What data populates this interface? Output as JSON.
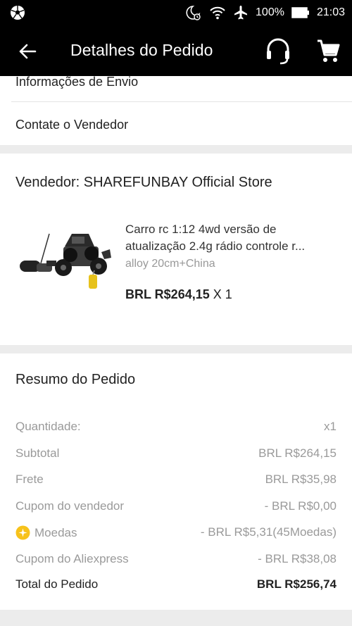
{
  "status_bar": {
    "battery": "100%",
    "time": "21:03",
    "icons": [
      "soccer-ball-icon",
      "do-not-disturb-moon-icon",
      "wifi-icon",
      "airplane-mode-icon",
      "battery-icon"
    ]
  },
  "app_bar": {
    "title": "Detalhes do Pedido",
    "icons": [
      "back-arrow-icon",
      "support-headset-icon",
      "shopping-cart-icon"
    ]
  },
  "links": {
    "shipping_info": "Informações de Envio",
    "contact_seller": "Contate o Vendedor"
  },
  "store": {
    "seller": "Vendedor: SHAREFUNBAY Official Store"
  },
  "product": {
    "title_line1": "Carro rc 1:12 4wd versão de",
    "title_line2": "atualização 2.4g rádio controle r...",
    "variant": "alloy 20cm+China",
    "price": "BRL R$264,15",
    "quantity": "X 1"
  },
  "summary": {
    "title": "Resumo do Pedido",
    "rows": [
      {
        "label": "Quantidade:",
        "value": "x1"
      },
      {
        "label": "Subtotal",
        "value": "BRL R$264,15"
      },
      {
        "label": "Frete",
        "value": "BRL R$35,98"
      },
      {
        "label": "Cupom do vendedor",
        "value": "- BRL R$0,00"
      },
      {
        "label": "Moedas",
        "value": "- BRL R$5,31(45Moedas)"
      },
      {
        "label": "Cupom do Aliexpress",
        "value": "- BRL R$38,08"
      },
      {
        "label": "Total do Pedido",
        "value": "BRL R$256,74"
      }
    ]
  },
  "colors": {
    "bar_background": "#000000",
    "coin": "#f7c21a",
    "muted_text": "#9a9a9a"
  }
}
